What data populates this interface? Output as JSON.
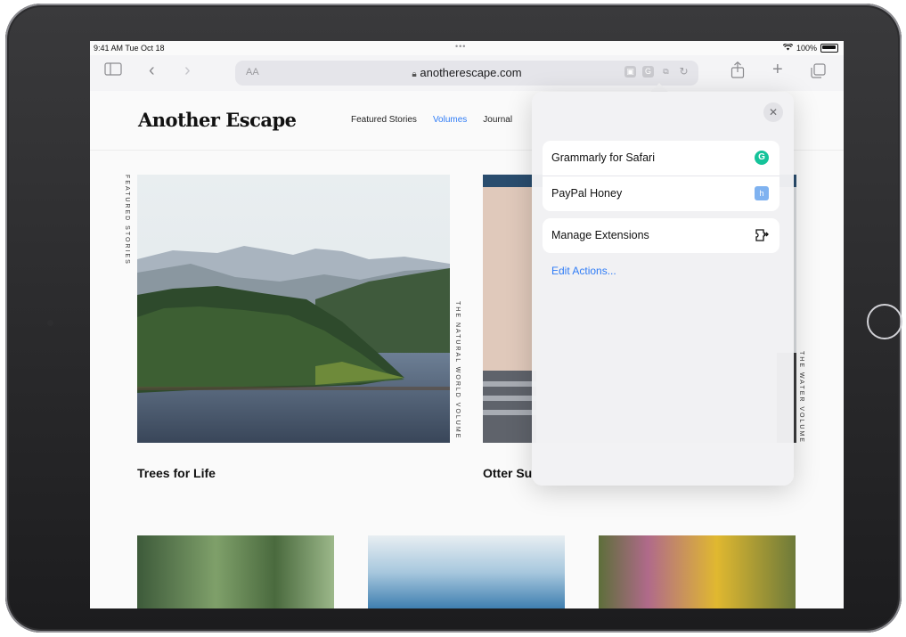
{
  "status_bar": {
    "time": "9:41 AM  Tue Oct 18",
    "dots": "•••",
    "battery": "100%"
  },
  "toolbar": {
    "text_size": "AA",
    "url": "anotherescape.com"
  },
  "site": {
    "logo": "Another Escape",
    "nav": [
      "Featured Stories",
      "Volumes",
      "Journal"
    ],
    "nav_active": "Volumes",
    "featured_label": "FEATURED STORIES",
    "cards": [
      {
        "side_label": "THE NATURAL WORLD VOLUME",
        "caption": "Trees for Life"
      },
      {
        "side_label": "THE WATER VOLUME",
        "caption": "Otter Su"
      }
    ]
  },
  "popover": {
    "close": "✕",
    "extensions": [
      {
        "label": "Grammarly for Safari",
        "icon": "grammarly-icon"
      },
      {
        "label": "PayPal Honey",
        "icon": "honey-icon"
      }
    ],
    "manage": "Manage Extensions",
    "edit_actions": "Edit Actions..."
  },
  "colors": {
    "accent": "#2f7cf6",
    "grammarly": "#15c39a",
    "honey": "#7fb2f0"
  }
}
